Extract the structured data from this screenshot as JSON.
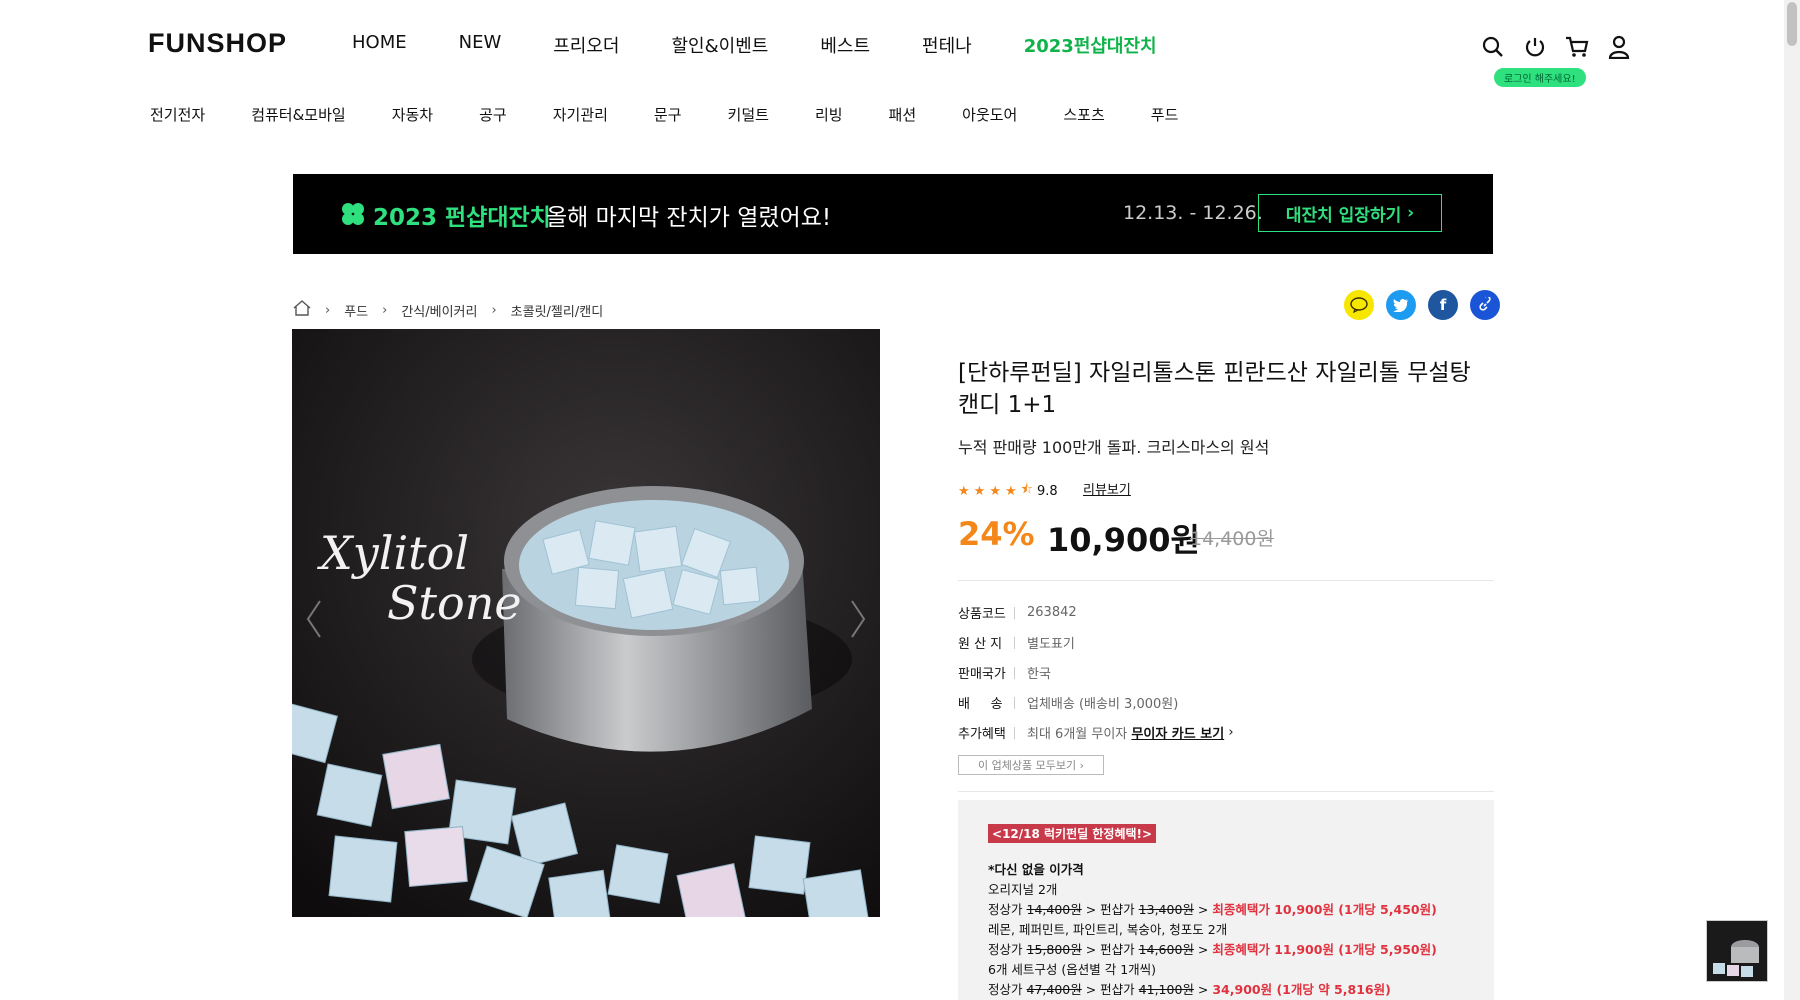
{
  "header": {
    "logo": "FUNSHOP",
    "nav": [
      "HOME",
      "NEW",
      "프리오더",
      "할인&이벤트",
      "베스트",
      "펀테나",
      "2023펀샵대잔치"
    ],
    "login_badge": "로그인 해주세요!",
    "categories": [
      "전기전자",
      "컴퓨터&모바일",
      "자동차",
      "공구",
      "자기관리",
      "문구",
      "키덜트",
      "리빙",
      "패션",
      "아웃도어",
      "스포츠",
      "푸드"
    ]
  },
  "banner": {
    "title": "2023 펀샵대잔치",
    "subtitle": "올해 마지막 잔치가 열렸어요!",
    "date": "12.13. - 12.26.",
    "button": "대잔치 입장하기"
  },
  "breadcrumb": [
    "푸드",
    "간식/베이커리",
    "초콜릿/젤리/캔디"
  ],
  "image_text": "Xylitol Stone",
  "product": {
    "title": "[단하루펀딜] 자일리톨스톤 핀란드산 자일리톨 무설탕캔디 1+1",
    "subtitle": "누적 판매량 100만개 돌파. 크리스마스의 원석",
    "rating": "9.8",
    "rating_stars": 4.5,
    "review_link": "리뷰보기",
    "discount": "24%",
    "price": "10,900원",
    "original_price": "14,400원"
  },
  "specs": [
    {
      "key": "상품코드",
      "value": "263842"
    },
    {
      "key": "원 산 지",
      "value": "별도표기"
    },
    {
      "key": "판매국가",
      "value": "한국"
    },
    {
      "key": "배     송",
      "value": "업체배송 (배송비 3,000원)"
    },
    {
      "key": "추가혜택",
      "value": "최대 6개월 무이자",
      "link": "무이자 카드 보기"
    }
  ],
  "all_products_button": "이 업체상품 모두보기",
  "benefit": {
    "tag": "12/18 럭키펀딜 한정혜택!",
    "heading": "*다신 없을 이가격",
    "l1": "오리지널 2개",
    "l2a": "정상가",
    "l2b": "14,400원",
    "l2c": "> 펀샵가",
    "l2d": "13,400원",
    "l2e": "> ",
    "l2f": "최종혜택가 10,900원 (1개당 5,450원)",
    "l3": "레몬, 페퍼민트, 파인트리, 복숭아, 청포도 2개",
    "l4a": "정상가",
    "l4b": "15,800원",
    "l4c": "> 펀샵가",
    "l4d": "14,600원",
    "l4e": "> ",
    "l4f": "최종혜택가 11,900원 (1개당 5,950원)",
    "l5": "6개 세트구성 (옵션별 각 1개씩)",
    "l6a": "정상가",
    "l6b": "47,400원",
    "l6c": "> 펀샵가",
    "l6d": "41,100원",
    "l6e": "> ",
    "l6f": "34,900원 (1개당 약 5,816원)"
  },
  "colors": {
    "accent_green": "#2fe07e",
    "discount_orange": "#f3871a",
    "benefit_red": "#e0323f"
  }
}
